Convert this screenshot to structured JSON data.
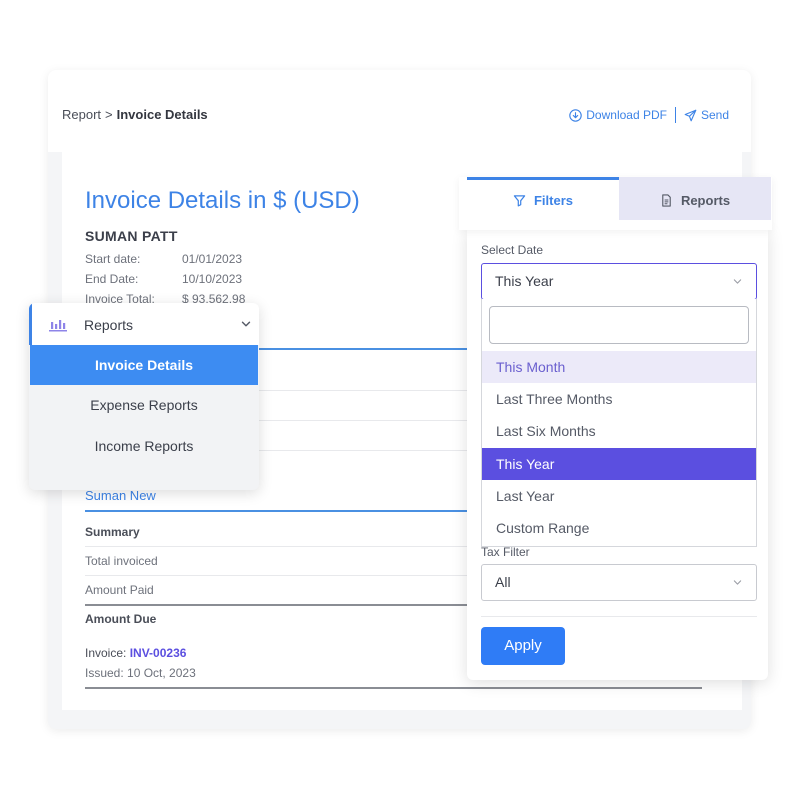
{
  "breadcrumb": {
    "root": "Report",
    "separator": ">",
    "current": "Invoice Details"
  },
  "actions": {
    "download_label": "Download PDF",
    "download_icon": "download-icon",
    "send_label": "Send",
    "send_icon": "send-icon"
  },
  "invoice": {
    "title": "Invoice Details in $ (USD)",
    "customer": "SUMAN PATT",
    "meta": [
      {
        "label": "Start date:",
        "value": "01/01/2023"
      },
      {
        "label": "End Date:",
        "value": "10/10/2023"
      },
      {
        "label": "Invoice Total:",
        "value": "$ 93,562.98"
      }
    ],
    "client_name": "Suman New",
    "summary_label": "Summary",
    "total_invoiced_label": "Total invoiced",
    "amount_paid_label": "Amount Paid",
    "amount_due_label": "Amount Due",
    "invoice_prefix": "Invoice:",
    "invoice_id": "INV-00236",
    "issued": "Issued: 10 Oct, 2023"
  },
  "side_menu": {
    "header": "Reports",
    "header_icon": "bar-chart-icon",
    "items": [
      {
        "label": "Invoice Details",
        "active": true
      },
      {
        "label": "Expense Reports",
        "active": false
      },
      {
        "label": "Income Reports",
        "active": false
      }
    ]
  },
  "filter_panel": {
    "tabs": [
      {
        "label": "Filters",
        "icon": "filter-icon",
        "active": true
      },
      {
        "label": "Reports",
        "icon": "document-icon",
        "active": false
      }
    ],
    "select_date_label": "Select Date",
    "select_date_value": "This Year",
    "date_options": [
      "This Month",
      "Last Three Months",
      "Last Six Months",
      "This Year",
      "Last Year",
      "Custom Range"
    ],
    "hovered_option": "This Month",
    "selected_option": "This Year",
    "tax_filter_label": "Tax Filter",
    "tax_filter_value": "All",
    "apply_label": "Apply"
  },
  "colors": {
    "accent": "#3d83e6",
    "selected": "#5b4fe0",
    "apply": "#2f7cf6",
    "hover": "#eceaf9"
  }
}
